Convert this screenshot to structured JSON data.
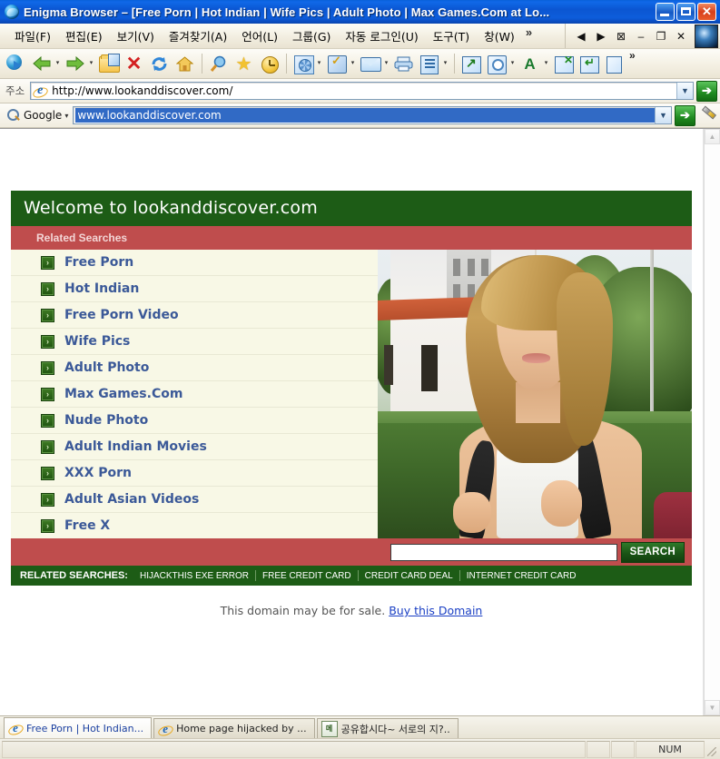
{
  "window": {
    "title": "Enigma Browser – [Free Porn | Hot Indian | Wife Pics | Adult Photo | Max Games.Com at Lo...",
    "minimize_label": "",
    "maximize_label": "",
    "close_label": ""
  },
  "menubar": {
    "items": [
      {
        "label": "파일(F)",
        "text": "파일",
        "accel": "F"
      },
      {
        "label": "편집(E)",
        "text": "편집",
        "accel": "E"
      },
      {
        "label": "보기(V)",
        "text": "보기",
        "accel": "V"
      },
      {
        "label": "즐겨찾기(A)",
        "text": "즐겨찾기",
        "accel": "A"
      },
      {
        "label": "언어(L)",
        "text": "언어",
        "accel": "L"
      },
      {
        "label": "그룹(G)",
        "text": "그룹",
        "accel": "G"
      },
      {
        "label": "자동 로그인(U)",
        "text": "자동 로그인",
        "accel": "U"
      },
      {
        "label": "도구(T)",
        "text": "도구",
        "accel": "T"
      },
      {
        "label": "창(W)",
        "text": "창",
        "accel": "W"
      }
    ],
    "overflow_chevron": "»",
    "doc_prev": "◀",
    "doc_next": "▶",
    "doc_close_box": "⊠",
    "doc_minimize": "–",
    "doc_restore": "❐",
    "doc_close": "✕"
  },
  "toolbar": {
    "icons": [
      "browse-globe-icon",
      "back-icon",
      "forward-icon",
      "open-folder-icon",
      "stop-icon",
      "refresh-icon",
      "home-icon",
      "search-icon",
      "favorites-star-icon",
      "history-clock-icon",
      "settings-gear-icon",
      "form-fill-icon",
      "mail-icon",
      "print-icon",
      "edit-icon",
      "external-window-icon",
      "zoom-icon",
      "font-icon",
      "close-window-icon",
      "restore-window-icon",
      "last-icon"
    ],
    "overflow_chevron": "»"
  },
  "address_bar": {
    "label": "주소",
    "value": "http://www.lookanddiscover.com/",
    "dropdown_icon": "chevron-down-icon",
    "go_label": "➔"
  },
  "search_bar": {
    "engine": "Google",
    "engine_caret": "▾",
    "value": "www.lookanddiscover.com",
    "dropdown_icon": "chevron-down-icon",
    "go_label": "➔",
    "highlighter_icon": "highlighter-icon"
  },
  "page": {
    "welcome_heading": "Welcome to lookanddiscover.com",
    "related_searches_heading": "Related Searches",
    "bullet_glyph": "›",
    "links": [
      "Free Porn",
      "Hot Indian",
      "Free Porn Video",
      "Wife Pics",
      "Adult Photo",
      "Max Games.Com",
      "Nude Photo",
      "Adult Indian Movies",
      "XXX Porn",
      "Adult Asian Videos",
      "Free X"
    ],
    "photo_alt": "smiling-blonde-student-with-backpack",
    "search": {
      "value": "",
      "placeholder": "",
      "button_label": "SEARCH"
    },
    "footer": {
      "title": "RELATED SEARCHES:",
      "items": [
        "HIJACKTHIS EXE ERROR",
        "FREE CREDIT CARD",
        "CREDIT CARD DEAL",
        "INTERNET CREDIT CARD"
      ]
    },
    "domain_note_text": "This domain may be for sale.",
    "domain_note_link": "Buy this Domain"
  },
  "scrollbar": {
    "up_arrow": "▲",
    "down_arrow": "▼"
  },
  "tabs": [
    {
      "label": "Free Porn | Hot Indian...",
      "icon": "ie-page-icon",
      "active": true
    },
    {
      "label": "Home page hijacked by ...",
      "icon": "ie-page-icon",
      "active": false
    },
    {
      "label": "공유합시다~ 서로의 지?..",
      "icon": "korean-page-icon",
      "active": false
    }
  ],
  "statusbar": {
    "message": "",
    "num_lock": "NUM"
  },
  "colors": {
    "title_blue": "#0b56d2",
    "page_green": "#1d5c16",
    "page_red": "#bf4d4d",
    "link_blue": "#3b5998",
    "list_bg": "#f8f8e6"
  }
}
